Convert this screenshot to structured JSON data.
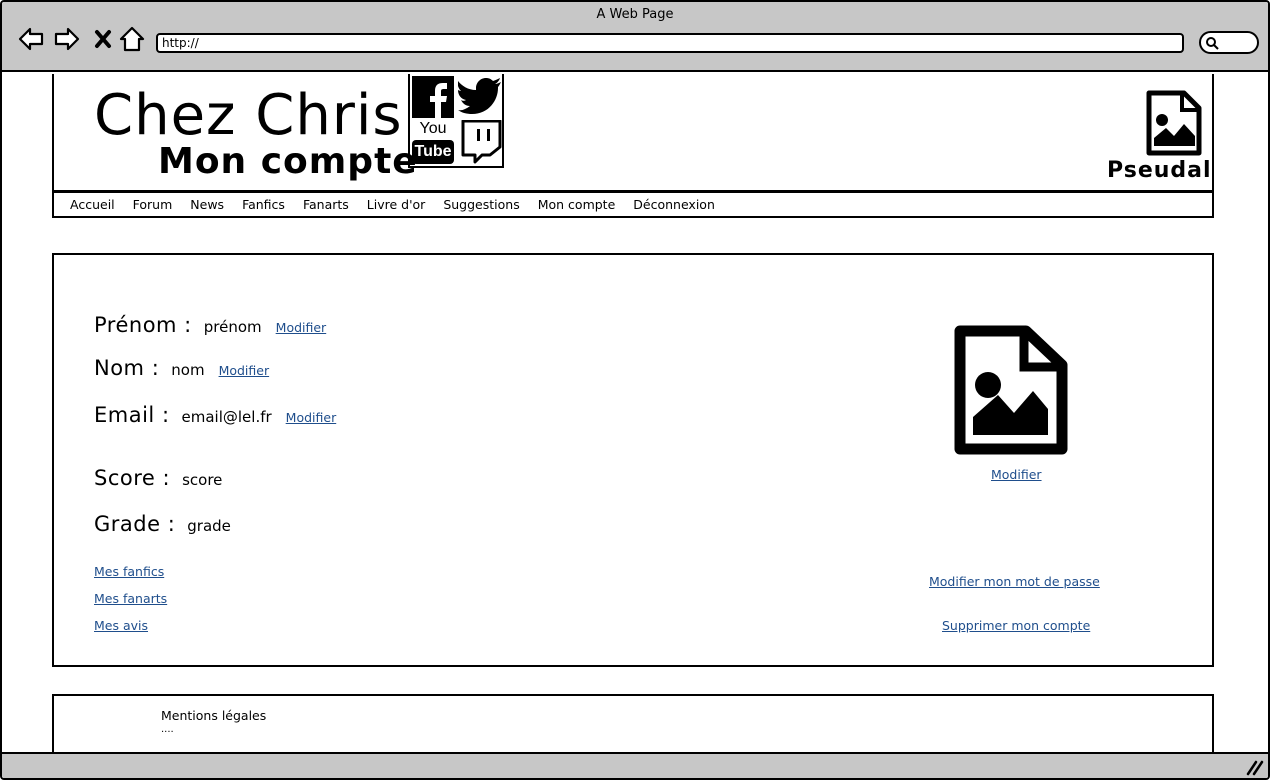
{
  "browser": {
    "window_title": "A Web Page",
    "url": "http://"
  },
  "header": {
    "site_title": "Chez Chris",
    "page_subtitle": "Mon compte",
    "username": "Pseudal",
    "social_icons": [
      "facebook-icon",
      "twitter-icon",
      "youtube-icon",
      "twitch-icon"
    ],
    "youtube_text": [
      "You",
      "Tube"
    ]
  },
  "menu": {
    "items": [
      "Accueil",
      "Forum",
      "News",
      "Fanfics",
      "Fanarts",
      "Livre d'or",
      "Suggestions",
      "Mon compte",
      "Déconnexion"
    ]
  },
  "profile": {
    "firstname": {
      "label": "Prénom :",
      "value": "prénom",
      "action": "Modifier"
    },
    "lastname": {
      "label": "Nom :",
      "value": "nom",
      "action": "Modifier"
    },
    "email": {
      "label": "Email :",
      "value": "email@lel.fr",
      "action": "Modifier"
    },
    "score": {
      "label": "Score :",
      "value": "score"
    },
    "grade": {
      "label": "Grade :",
      "value": "grade"
    },
    "avatar_action": "Modifier",
    "links": [
      "Mes fanfics",
      "Mes fanarts",
      "Mes avis"
    ],
    "change_password": "Modifier mon mot de passe",
    "delete_account": "Supprimer mon compte"
  },
  "footer": {
    "legal": "Mentions légales",
    "more": "...."
  },
  "colors": {
    "chrome": "#c7c7c7",
    "link": "#1f4e8c"
  }
}
